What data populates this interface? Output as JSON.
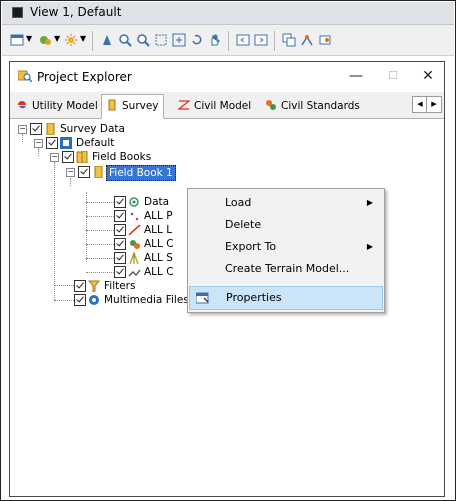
{
  "window": {
    "title": "View 1, Default"
  },
  "panel": {
    "title": "Project Explorer",
    "minimize": "—",
    "maximize": "☐",
    "close": "✕"
  },
  "tabs": [
    {
      "label": "Utility Model"
    },
    {
      "label": "Survey"
    },
    {
      "label": "Civil Model"
    },
    {
      "label": "Civil Standards"
    }
  ],
  "tab_scroll": {
    "left": "◀",
    "right": "▶"
  },
  "tree": {
    "survey_data": "Survey Data",
    "default": "Default",
    "field_books": "Field Books",
    "field_book_1": "Field Book 1",
    "data": "Data",
    "all_1": "ALL P",
    "all_2": "ALL L",
    "all_3": "ALL C",
    "all_4": "ALL S",
    "all_5": "ALL C",
    "filters": "Filters",
    "multimedia": "Multimedia Files"
  },
  "context_menu": {
    "items": [
      {
        "label": "Load",
        "submenu": true
      },
      {
        "label": "Delete",
        "submenu": false
      },
      {
        "label": "Export To",
        "submenu": true
      },
      {
        "label": "Create Terrain Model...",
        "submenu": false
      },
      {
        "label": "Properties",
        "submenu": false,
        "highlighted": true
      }
    ],
    "arrow": "▶"
  },
  "colors": {
    "selection": "#3875d7",
    "menu_highlight": "#cce4f7"
  }
}
